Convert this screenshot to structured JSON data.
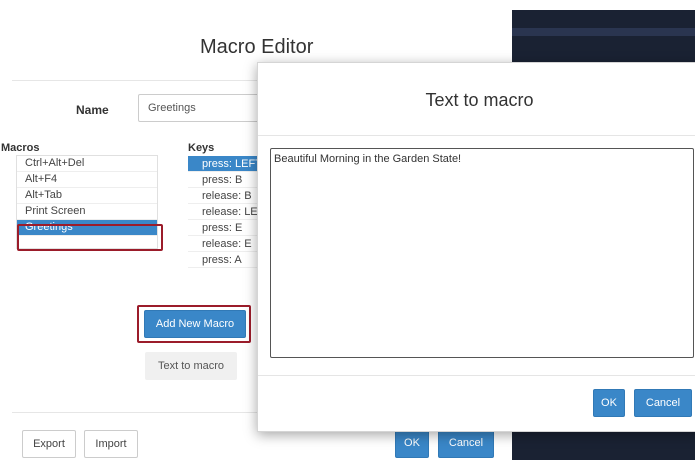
{
  "editor": {
    "title": "Macro Editor",
    "name_label": "Name",
    "name_value": "Greetings",
    "macros_label": "Macros",
    "macros": [
      {
        "label": "Ctrl+Alt+Del",
        "selected": false
      },
      {
        "label": "Alt+F4",
        "selected": false
      },
      {
        "label": "Alt+Tab",
        "selected": false
      },
      {
        "label": "Print Screen",
        "selected": false
      },
      {
        "label": "Greetings",
        "selected": true
      }
    ],
    "keys_label": "Keys",
    "keys": [
      {
        "label": "press: LEFT",
        "selected": true
      },
      {
        "label": "press: B",
        "selected": false
      },
      {
        "label": "release: B",
        "selected": false
      },
      {
        "label": "release: LEFT",
        "selected": false
      },
      {
        "label": "press: E",
        "selected": false
      },
      {
        "label": "release: E",
        "selected": false
      },
      {
        "label": "press: A",
        "selected": false
      }
    ],
    "add_new_macro_label": "Add New Macro",
    "text_to_macro_label": "Text to macro",
    "export_label": "Export",
    "import_label": "Import",
    "ok_label": "OK",
    "cancel_label": "Cancel"
  },
  "dialog": {
    "title": "Text to macro",
    "text_value": "Beautiful Morning in the Garden State!",
    "ok_label": "OK",
    "cancel_label": "Cancel"
  },
  "colors": {
    "primary": "#3a87c8",
    "highlight_border": "#9b1c2a",
    "dark_background": "#1a2233"
  }
}
